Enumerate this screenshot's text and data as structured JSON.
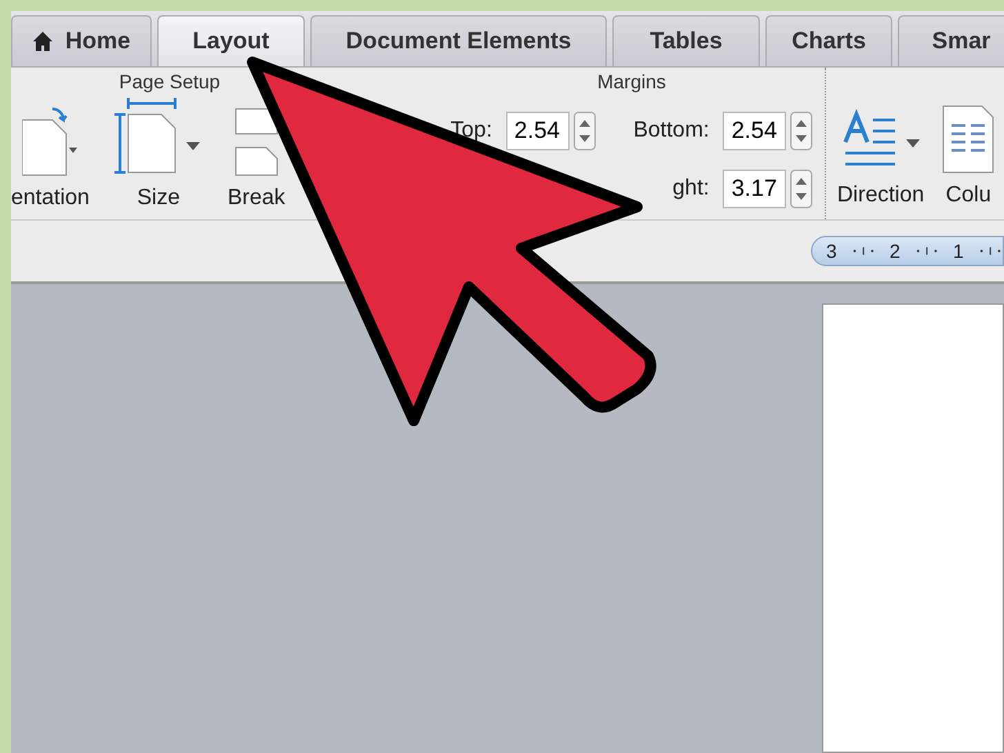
{
  "tabs": [
    {
      "label": "Home",
      "kind": "home",
      "selected": false
    },
    {
      "label": "Layout",
      "selected": true
    },
    {
      "label": "Document Elements",
      "selected": false
    },
    {
      "label": "Tables",
      "selected": false
    },
    {
      "label": "Charts",
      "selected": false
    },
    {
      "label": "Smar",
      "selected": false
    }
  ],
  "page_setup": {
    "title": "Page Setup",
    "buttons": [
      {
        "label": "entation",
        "kind": "orientation"
      },
      {
        "label": "Size",
        "kind": "size"
      },
      {
        "label": "Break",
        "kind": "break"
      }
    ]
  },
  "margins": {
    "title": "Margins",
    "fields": [
      {
        "label": "Top:",
        "value": "2.54"
      },
      {
        "label": "Bottom:",
        "value": "2.54"
      },
      {
        "label": "ght:",
        "value": "3.17"
      }
    ]
  },
  "text_group": {
    "buttons": [
      {
        "label": "Direction",
        "kind": "direction"
      },
      {
        "label": "Colu",
        "kind": "columns"
      }
    ]
  },
  "ruler": {
    "marks": [
      "3",
      "2",
      "1"
    ]
  }
}
